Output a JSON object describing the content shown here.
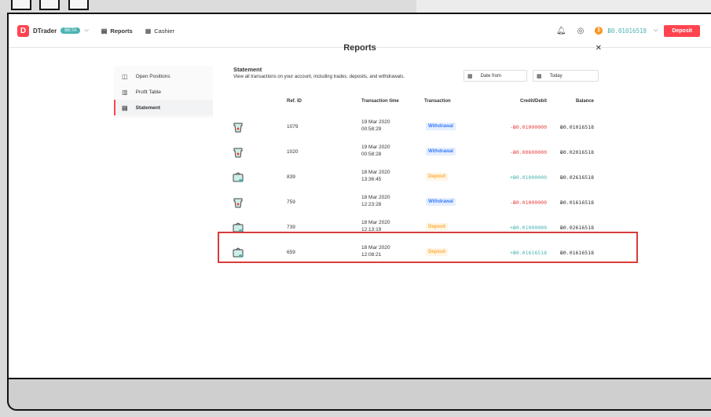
{
  "header": {
    "brand": "DTrader",
    "beta": "BETA",
    "nav_reports": "Reports",
    "nav_cashier": "Cashier",
    "balance": "Ƀ0.01016518",
    "deposit_label": "Deposit"
  },
  "page": {
    "title": "Reports",
    "close": "✕"
  },
  "sidebar": {
    "items": [
      {
        "label": "Open Positions"
      },
      {
        "label": "Profit Table"
      },
      {
        "label": "Statement"
      }
    ]
  },
  "statement": {
    "title": "Statement",
    "description": "View all transactions on your account, including trades, deposits, and withdrawals.",
    "date_from_placeholder": "Date from",
    "date_to": "Today"
  },
  "table": {
    "headers": {
      "ref": "Ref. ID",
      "time": "Transaction time",
      "type": "Transaction",
      "credit": "Credit/Debit",
      "balance": "Balance"
    },
    "rows": [
      {
        "ref": "1079",
        "date": "19 Mar 2020",
        "time": "00:58:29",
        "type": "Withdrawal",
        "credit": "-Ƀ0.01000000",
        "balance": "Ƀ0.01016518"
      },
      {
        "ref": "1020",
        "date": "19 Mar 2020",
        "time": "00:58:28",
        "type": "Withdrawal",
        "credit": "-Ƀ0.00600000",
        "balance": "Ƀ0.02016518"
      },
      {
        "ref": "839",
        "date": "18 Mar 2020",
        "time": "13:36:45",
        "type": "Deposit",
        "credit": "+Ƀ0.01000000",
        "balance": "Ƀ0.02616518"
      },
      {
        "ref": "759",
        "date": "18 Mar 2020",
        "time": "12:23:28",
        "type": "Withdrawal",
        "credit": "-Ƀ0.01000000",
        "balance": "Ƀ0.01616518"
      },
      {
        "ref": "739",
        "date": "18 Mar 2020",
        "time": "12:13:19",
        "type": "Deposit",
        "credit": "+Ƀ0.01000000",
        "balance": "Ƀ0.02616518"
      },
      {
        "ref": "659",
        "date": "18 Mar 2020",
        "time": "12:08:21",
        "type": "Deposit",
        "credit": "+Ƀ0.01616518",
        "balance": "Ƀ0.01616518"
      }
    ]
  },
  "colors": {
    "accent": "#ff444f",
    "positive": "#4bb4b3",
    "negative": "#ec3f3f",
    "withdrawal": "#377cfc",
    "deposit": "#ffad3a"
  }
}
